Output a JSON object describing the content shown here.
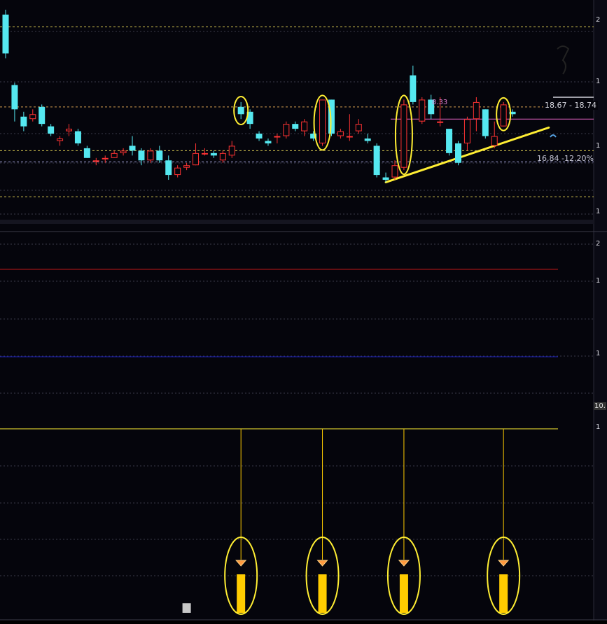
{
  "chart_data": {
    "type": "candlestick",
    "title": "",
    "candles": [
      [
        22.9,
        21.3,
        23.1,
        21.1
      ],
      [
        20.0,
        19.0,
        20.1,
        18.5
      ],
      [
        18.7,
        18.3,
        18.9,
        18.1
      ],
      [
        18.6,
        18.8,
        19.0,
        18.5
      ],
      [
        19.1,
        18.4,
        19.2,
        18.3
      ],
      [
        18.3,
        18.0,
        18.4,
        17.9
      ],
      [
        17.7,
        17.8,
        17.9,
        17.5
      ],
      [
        18.1,
        18.2,
        18.4,
        17.9
      ],
      [
        18.1,
        17.6,
        18.2,
        17.5
      ],
      [
        17.4,
        17.0,
        17.5,
        17.0
      ],
      [
        16.9,
        16.9,
        17.0,
        16.7
      ],
      [
        17.0,
        17.0,
        17.1,
        16.8
      ],
      [
        17.0,
        17.2,
        17.3,
        17.0
      ],
      [
        17.2,
        17.3,
        17.4,
        17.1
      ],
      [
        17.5,
        17.3,
        17.9,
        17.1
      ],
      [
        17.3,
        16.9,
        17.4,
        16.7
      ],
      [
        16.9,
        17.3,
        17.4,
        16.8
      ],
      [
        17.3,
        16.9,
        17.5,
        16.8
      ],
      [
        16.9,
        16.3,
        17.1,
        16.1
      ],
      [
        16.3,
        16.6,
        16.7,
        16.2
      ],
      [
        16.6,
        16.7,
        16.8,
        16.5
      ],
      [
        16.7,
        17.2,
        17.6,
        16.7
      ],
      [
        17.2,
        17.2,
        17.4,
        17.1
      ],
      [
        17.2,
        17.1,
        17.3,
        17.0
      ],
      [
        16.9,
        17.2,
        17.3,
        16.8
      ],
      [
        17.1,
        17.5,
        17.7,
        17.0
      ],
      [
        19.1,
        18.8,
        19.3,
        18.6
      ],
      [
        18.9,
        18.4,
        19.0,
        18.2
      ],
      [
        18.0,
        17.8,
        18.1,
        17.7
      ],
      [
        17.7,
        17.6,
        17.8,
        17.5
      ],
      [
        17.9,
        17.9,
        18.0,
        17.6
      ],
      [
        17.9,
        18.4,
        18.5,
        17.8
      ],
      [
        18.4,
        18.2,
        18.5,
        18.1
      ],
      [
        18.1,
        18.5,
        18.6,
        17.9
      ],
      [
        18.0,
        17.8,
        18.1,
        17.7
      ],
      [
        17.6,
        19.4,
        19.4,
        17.5
      ],
      [
        19.4,
        18.0,
        19.4,
        17.9
      ],
      [
        17.9,
        18.1,
        18.2,
        17.8
      ],
      [
        17.9,
        17.9,
        18.8,
        17.7
      ],
      [
        18.1,
        18.4,
        18.6,
        18.0
      ],
      [
        17.8,
        17.7,
        18.0,
        17.6
      ],
      [
        17.5,
        16.3,
        17.6,
        16.2
      ],
      [
        16.2,
        16.1,
        16.4,
        16.0
      ],
      [
        16.2,
        16.7,
        16.9,
        16.1
      ],
      [
        16.6,
        19.2,
        19.4,
        16.5
      ],
      [
        20.4,
        19.3,
        20.8,
        19.2
      ],
      [
        18.5,
        19.4,
        19.5,
        18.4
      ],
      [
        19.4,
        18.8,
        19.6,
        18.6
      ],
      [
        18.5,
        18.5,
        19.5,
        18.3
      ],
      [
        18.2,
        17.2,
        18.2,
        17.1
      ],
      [
        17.6,
        16.8,
        17.7,
        16.7
      ],
      [
        17.6,
        18.6,
        18.7,
        17.3
      ],
      [
        18.6,
        19.3,
        19.5,
        18.1
      ],
      [
        19.0,
        17.9,
        19.0,
        17.8
      ],
      [
        17.5,
        17.9,
        18.5,
        17.4
      ],
      [
        18.3,
        19.2,
        19.3,
        18.3
      ],
      [
        18.9,
        18.8,
        19.0,
        18.7
      ]
    ],
    "price_ylim": [
      14.0,
      23.5
    ],
    "price_levels": [
      {
        "value": 22.4,
        "color": "#d8c850"
      },
      {
        "value": 19.1,
        "color": "#d8a050"
      },
      {
        "value": 17.3,
        "color": "#d8c850"
      },
      {
        "value": 16.84,
        "color": "#9a9ad0"
      },
      {
        "value": 15.4,
        "color": "#d8c850"
      }
    ],
    "trendline": {
      "from": [
        42,
        16.0
      ],
      "to": [
        60,
        18.25
      ],
      "color": "#ffee33"
    },
    "range_line": {
      "from_index": 43,
      "value": 18.6,
      "color": "#e060c0"
    },
    "annotations": {
      "range_text": "18.67 - 18.74",
      "level_text": "16.84 -12.20%",
      "small_text": "8.33",
      "axis_readout": "10."
    },
    "axis_tick_labels": [
      "2",
      "1",
      "1",
      "1",
      "2",
      "1",
      "1",
      "1"
    ],
    "indicator_lines": [
      {
        "panel": "middle",
        "value": 0.8,
        "color": "#c01818"
      },
      {
        "panel": "middle",
        "value": 0.3,
        "color": "#1a20c0"
      }
    ],
    "signals": [
      26,
      35,
      44,
      55
    ],
    "volume_bars": [
      {
        "index": 20,
        "value": 0.25,
        "color": "#c8c8c8"
      },
      {
        "index": 26,
        "value": 1.0,
        "color": "#ffcc00"
      },
      {
        "index": 35,
        "value": 1.0,
        "color": "#ffcc00"
      },
      {
        "index": 44,
        "value": 1.0,
        "color": "#ffcc00"
      },
      {
        "index": 55,
        "value": 1.0,
        "color": "#ffcc00"
      }
    ],
    "colors": {
      "up": "#ff3333",
      "down": "#55e8f0",
      "highlight": "#ffee33",
      "grid": "#3a3a4a",
      "background": "#05050c"
    }
  }
}
